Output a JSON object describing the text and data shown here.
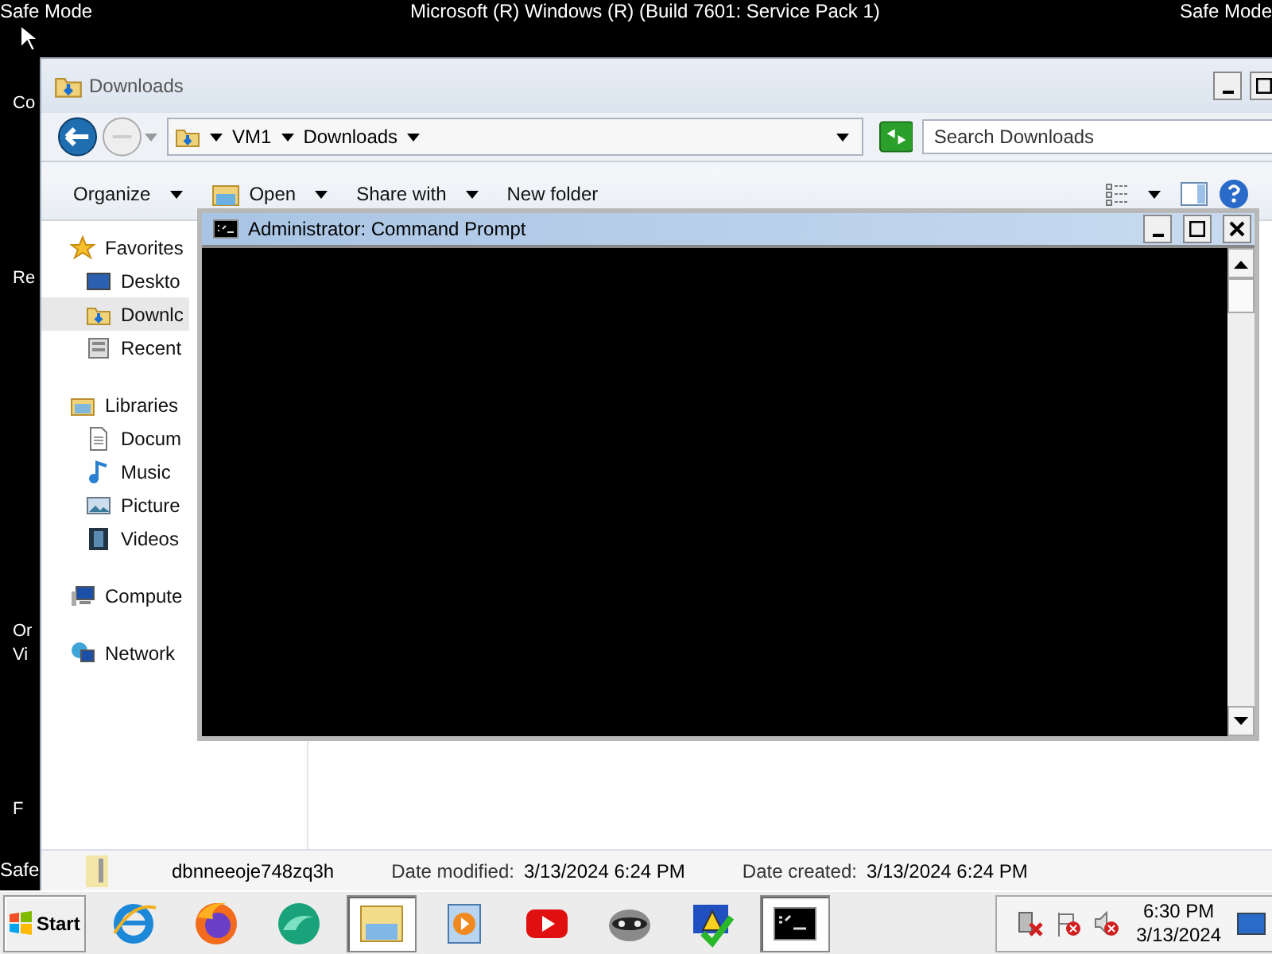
{
  "desktop": {
    "top_left_label": "Safe Mode",
    "top_center_label": "Microsoft (R) Windows (R) (Build 7601: Service Pack 1)",
    "top_right_label": "Safe Mode",
    "bottom_left_label": "Safe",
    "icon_labels": [
      "Co",
      "Re",
      "Or",
      "Vi",
      "F"
    ]
  },
  "explorer": {
    "title": "Downloads",
    "breadcrumbs": [
      "VM1",
      "Downloads"
    ],
    "search": {
      "placeholder": "Search Downloads"
    },
    "toolbar": [
      {
        "label": "Organize",
        "has_menu": true
      },
      {
        "label": "Open",
        "has_menu": true
      },
      {
        "label": "Share with",
        "has_menu": true
      },
      {
        "label": "New folder",
        "has_menu": false
      }
    ],
    "nav": [
      {
        "label": "Favorites",
        "children": [
          {
            "label": "Deskto",
            "selected": false
          },
          {
            "label": "Downlc",
            "selected": true
          },
          {
            "label": "Recent",
            "selected": false
          }
        ]
      },
      {
        "label": "Libraries",
        "children": [
          {
            "label": "Docum",
            "selected": false
          },
          {
            "label": "Music",
            "selected": false
          },
          {
            "label": "Picture",
            "selected": false
          },
          {
            "label": "Videos",
            "selected": false
          }
        ]
      },
      {
        "label": "Compute"
      },
      {
        "label": "Network"
      }
    ],
    "details": {
      "name": "dbnneeoje748zq3h",
      "modified_label": "Date modified:",
      "modified": "3/13/2024 6:24 PM",
      "created_label": "Date created:",
      "created": "3/13/2024 6:24 PM"
    }
  },
  "cmd": {
    "title": "Administrator:  Command Prompt"
  },
  "taskbar": {
    "start": "Start",
    "apps": [
      {
        "active": false
      },
      {
        "active": false
      },
      {
        "active": false
      },
      {
        "active": true
      },
      {
        "active": false
      },
      {
        "active": false
      },
      {
        "active": false
      },
      {
        "active": false
      },
      {
        "active": true
      }
    ],
    "time": "6:30 PM",
    "date": "3/13/2024"
  }
}
